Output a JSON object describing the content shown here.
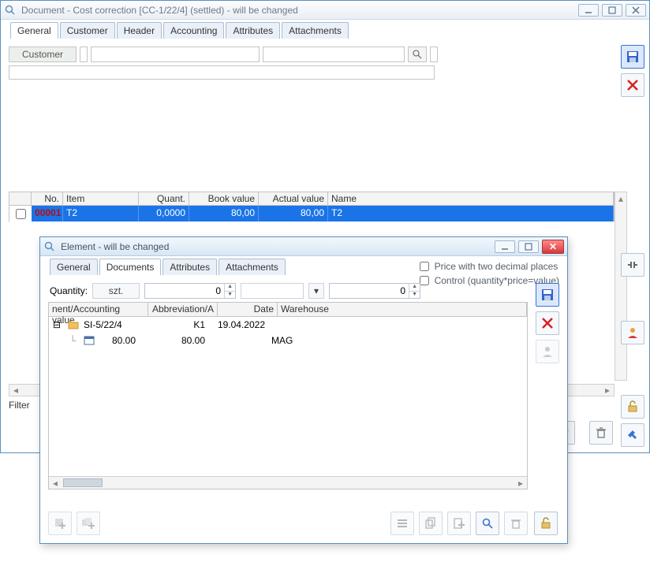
{
  "outer": {
    "title": "Document - Cost correction [CC-1/22/4] (settled) - will be changed",
    "tabs": [
      "General",
      "Customer",
      "Header",
      "Accounting",
      "Attributes",
      "Attachments"
    ],
    "activeTab": 0,
    "customerLabel": "Customer",
    "grid": {
      "headers": {
        "no": "No.",
        "item": "Item",
        "quant": "Quant.",
        "book": "Book value",
        "actual": "Actual value",
        "name": "Name"
      },
      "row": {
        "no": "00001",
        "item": "T2",
        "quant": "0,0000",
        "book": "80,00",
        "actual": "80,00",
        "name": "T2"
      }
    },
    "filterLabel": "Filter"
  },
  "inner": {
    "title": "Element - will be changed",
    "tabs": [
      "General",
      "Documents",
      "Attributes",
      "Attachments"
    ],
    "activeTab": 1,
    "priceLabel": "Price with two decimal places",
    "controlLabel": "Control (quantity*price=value)",
    "quantityLabel": "Quantity:",
    "unit": "szt.",
    "spin1": "0",
    "spin2": "0",
    "grid": {
      "headers": {
        "c1": "nent/Accounting value",
        "c2": "Abbreviation/A",
        "c3": "Date",
        "c4": "Warehouse"
      },
      "row1": {
        "c1": "SI-5/22/4",
        "c2": "K1",
        "c3": "19.04.2022",
        "c4": ""
      },
      "row2": {
        "c1": "80.00",
        "c2": "80.00",
        "c3": "",
        "c4": "MAG"
      }
    }
  }
}
